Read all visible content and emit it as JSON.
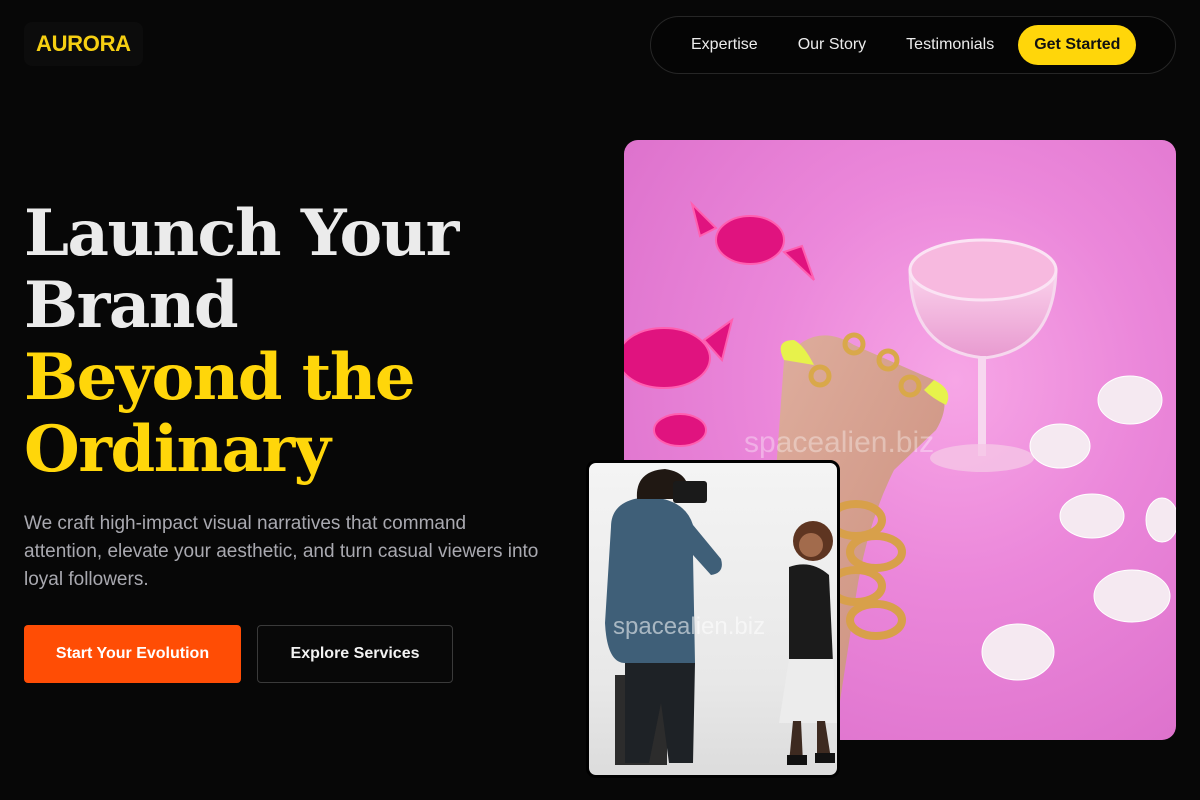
{
  "brand": {
    "name": "AURORA"
  },
  "nav": {
    "links": [
      "Expertise",
      "Our Story",
      "Testimonials"
    ],
    "cta": "Get Started"
  },
  "hero": {
    "title_white": [
      "Launch Your",
      "Brand"
    ],
    "title_yellow": [
      "Beyond the",
      "Ordinary"
    ],
    "subtitle": "We craft high-impact visual narratives that command attention, elevate your aesthetic, and turn casual viewers into loyal followers.",
    "primary_button": "Start Your Evolution",
    "secondary_button": "Explore Services"
  },
  "images": {
    "large_watermark": "spacealien.biz",
    "small_watermark": "spacealien.biz"
  },
  "colors": {
    "background": "#070707",
    "accent_yellow": "#ffd60a",
    "accent_orange": "#ff4d05"
  }
}
